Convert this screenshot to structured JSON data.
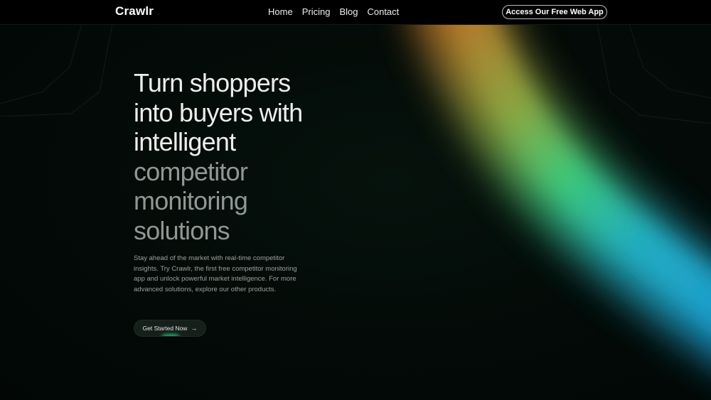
{
  "brand": {
    "logo_text": "Crawlr"
  },
  "nav": {
    "links": [
      {
        "label": "Home"
      },
      {
        "label": "Pricing"
      },
      {
        "label": "Blog"
      },
      {
        "label": "Contact"
      }
    ],
    "cta_label": "Access Our Free Web App"
  },
  "hero": {
    "title_lines_bright": [
      "Turn shoppers",
      "into buyers with",
      "intelligent"
    ],
    "title_lines_dim": [
      "competitor",
      "monitoring",
      "solutions"
    ],
    "description": "Stay ahead of the market with real-time competitor insights. Try Crawlr, the first free competitor monitoring app and unlock powerful market intelligence. For more advanced solutions, explore our other products.",
    "button_label": "Get Started Now",
    "button_icon": "arrow-right-icon"
  },
  "colors": {
    "background": "#030a07",
    "navbar": "#000000",
    "title_bright": "#ededed",
    "title_dim": "#8f9893",
    "glow_orange": "#c07a2a",
    "glow_green": "#3fcf7c",
    "glow_cyan": "#22b3c9"
  }
}
